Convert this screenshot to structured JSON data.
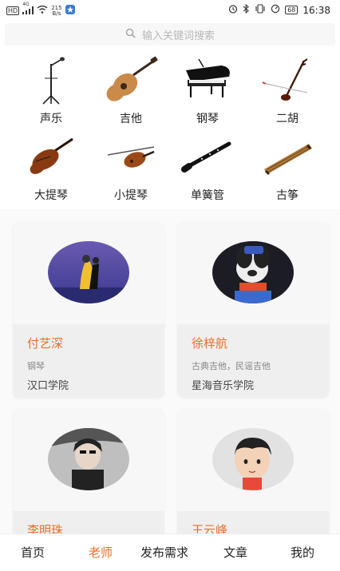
{
  "status_bar": {
    "left_tags": [
      "HD",
      "4G"
    ],
    "speed_value": "215",
    "speed_unit": "B/s",
    "battery": "68",
    "time": "16:38"
  },
  "search": {
    "placeholder": "输入关键词搜索"
  },
  "instruments": [
    {
      "label": "声乐",
      "icon": "microphone-stand-icon"
    },
    {
      "label": "吉他",
      "icon": "guitar-icon"
    },
    {
      "label": "钢琴",
      "icon": "grand-piano-icon"
    },
    {
      "label": "二胡",
      "icon": "erhu-icon"
    },
    {
      "label": "大提琴",
      "icon": "cello-icon"
    },
    {
      "label": "小提琴",
      "icon": "violin-icon"
    },
    {
      "label": "单簧管",
      "icon": "clarinet-icon"
    },
    {
      "label": "古筝",
      "icon": "guzheng-icon"
    }
  ],
  "teachers": [
    {
      "name": "付艺深",
      "subject": "钢琴",
      "school": "汉口学院"
    },
    {
      "name": "徐梓航",
      "subject": "古典吉他，民谣吉他",
      "school": "星海音乐学院"
    },
    {
      "name": "李明珠",
      "subject": "",
      "school": ""
    },
    {
      "name": "王云峰",
      "subject": "",
      "school": ""
    }
  ],
  "tabs": [
    {
      "label": "首页",
      "active": false
    },
    {
      "label": "老师",
      "active": true
    },
    {
      "label": "发布需求",
      "active": false
    },
    {
      "label": "文章",
      "active": false
    },
    {
      "label": "我的",
      "active": false
    }
  ],
  "colors": {
    "accent": "#e8702a"
  }
}
